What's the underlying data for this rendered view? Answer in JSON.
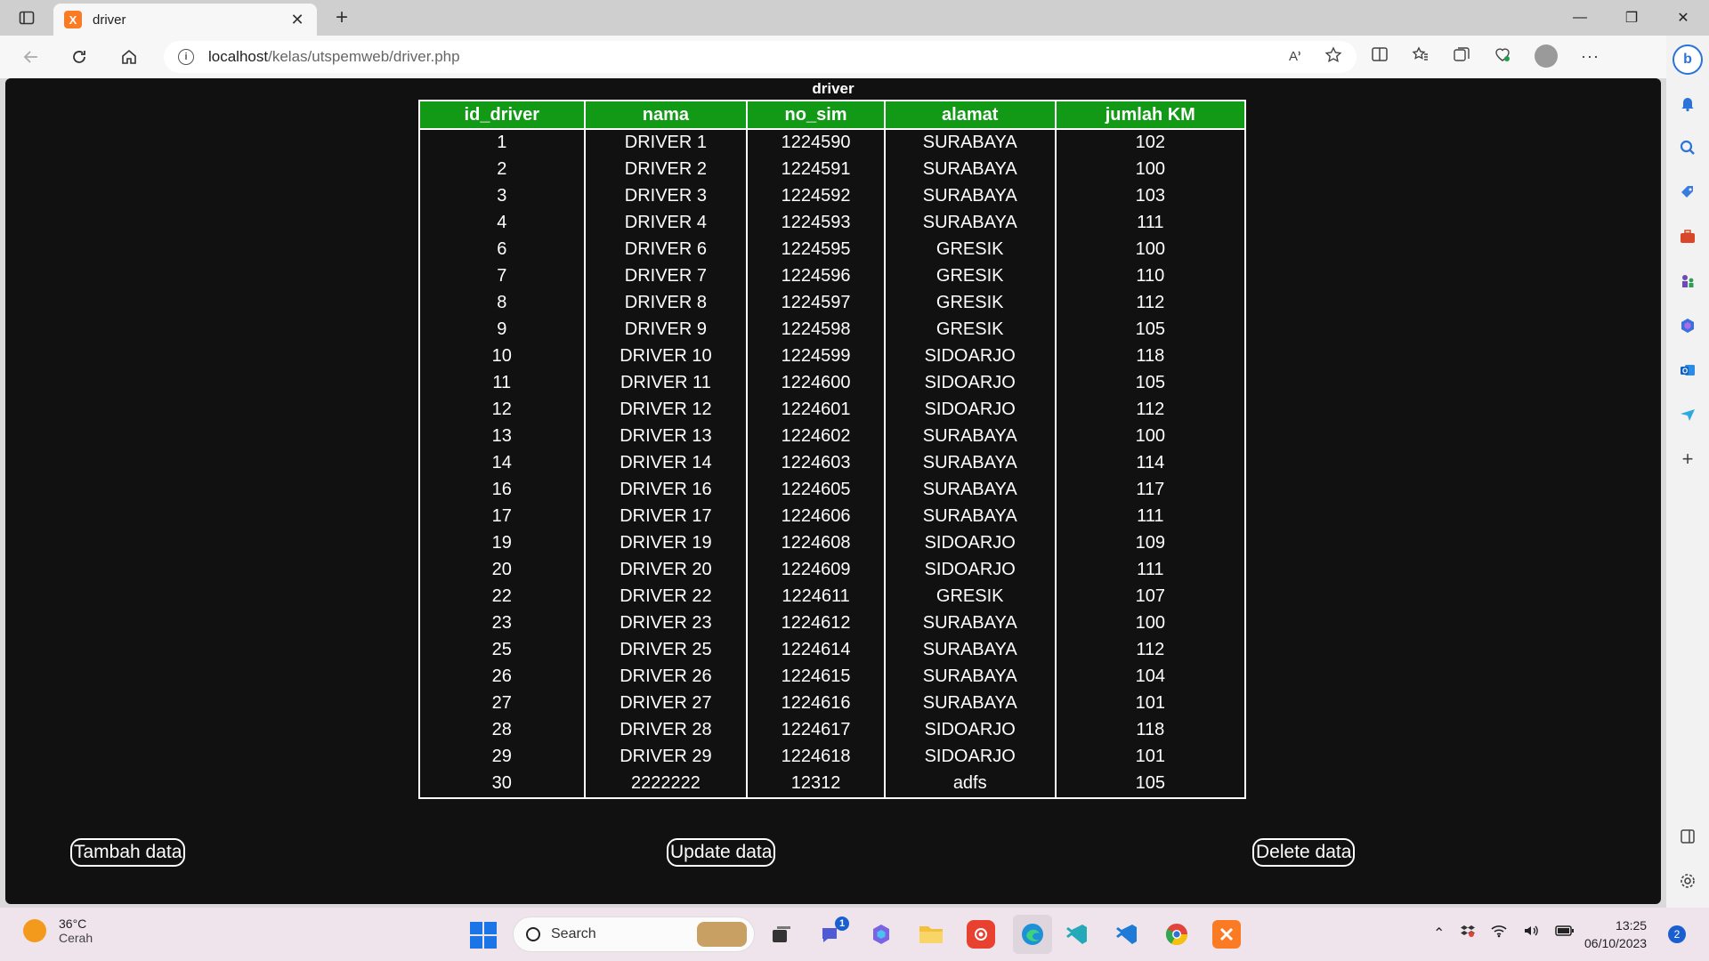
{
  "browser": {
    "tab_title": "driver",
    "tab_favicon": "X",
    "url_host": "localhost",
    "url_path": "/kelas/utspemweb/driver.php"
  },
  "page": {
    "title": "driver",
    "headers": [
      "id_driver",
      "nama",
      "no_sim",
      "alamat",
      "jumlah KM"
    ],
    "rows": [
      [
        "1",
        "DRIVER 1",
        "1224590",
        "SURABAYA",
        "102"
      ],
      [
        "2",
        "DRIVER 2",
        "1224591",
        "SURABAYA",
        "100"
      ],
      [
        "3",
        "DRIVER 3",
        "1224592",
        "SURABAYA",
        "103"
      ],
      [
        "4",
        "DRIVER 4",
        "1224593",
        "SURABAYA",
        "111"
      ],
      [
        "6",
        "DRIVER 6",
        "1224595",
        "GRESIK",
        "100"
      ],
      [
        "7",
        "DRIVER 7",
        "1224596",
        "GRESIK",
        "110"
      ],
      [
        "8",
        "DRIVER 8",
        "1224597",
        "GRESIK",
        "112"
      ],
      [
        "9",
        "DRIVER 9",
        "1224598",
        "GRESIK",
        "105"
      ],
      [
        "10",
        "DRIVER 10",
        "1224599",
        "SIDOARJO",
        "118"
      ],
      [
        "11",
        "DRIVER 11",
        "1224600",
        "SIDOARJO",
        "105"
      ],
      [
        "12",
        "DRIVER 12",
        "1224601",
        "SIDOARJO",
        "112"
      ],
      [
        "13",
        "DRIVER 13",
        "1224602",
        "SURABAYA",
        "100"
      ],
      [
        "14",
        "DRIVER 14",
        "1224603",
        "SURABAYA",
        "114"
      ],
      [
        "16",
        "DRIVER 16",
        "1224605",
        "SURABAYA",
        "117"
      ],
      [
        "17",
        "DRIVER 17",
        "1224606",
        "SURABAYA",
        "111"
      ],
      [
        "19",
        "DRIVER 19",
        "1224608",
        "SIDOARJO",
        "109"
      ],
      [
        "20",
        "DRIVER 20",
        "1224609",
        "SIDOARJO",
        "111"
      ],
      [
        "22",
        "DRIVER 22",
        "1224611",
        "GRESIK",
        "107"
      ],
      [
        "23",
        "DRIVER 23",
        "1224612",
        "SURABAYA",
        "100"
      ],
      [
        "25",
        "DRIVER 25",
        "1224614",
        "SURABAYA",
        "112"
      ],
      [
        "26",
        "DRIVER 26",
        "1224615",
        "SURABAYA",
        "104"
      ],
      [
        "27",
        "DRIVER 27",
        "1224616",
        "SURABAYA",
        "101"
      ],
      [
        "28",
        "DRIVER 28",
        "1224617",
        "SIDOARJO",
        "118"
      ],
      [
        "29",
        "DRIVER 29",
        "1224618",
        "SIDOARJO",
        "101"
      ],
      [
        "30",
        "2222222",
        "12312",
        "adfs",
        "105"
      ]
    ],
    "buttons": {
      "tambah": "Tambah data",
      "update": "Update data",
      "delete": "Delete data"
    },
    "colors": {
      "header_bg": "#129a17",
      "page_bg": "#111111"
    }
  },
  "taskbar": {
    "weather_temp": "36°C",
    "weather_desc": "Cerah",
    "search_placeholder": "Search",
    "time": "13:25",
    "date": "06/10/2023",
    "notification_count": "2",
    "chat_badge": "1"
  }
}
